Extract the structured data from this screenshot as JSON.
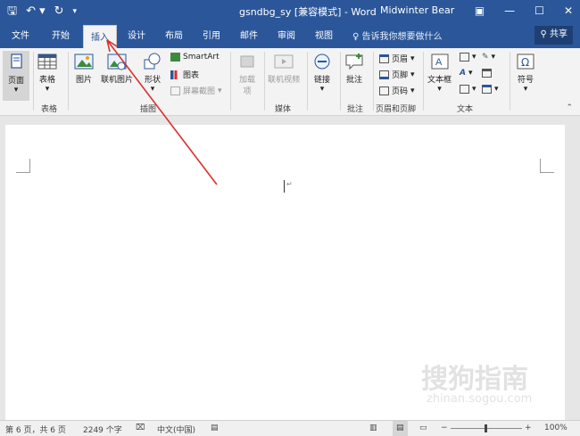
{
  "titlebar": {
    "title": "gsndbg_sy [兼容模式] - Word",
    "user": "Midwinter Bear",
    "qat": {
      "save": "🖫",
      "undo": "↶ ▾",
      "redo": "↻",
      "customize": "▾"
    },
    "window_buttons": {
      "ribbon_display": "▣",
      "minimize": "—",
      "maximize": "☐",
      "close": "✕"
    }
  },
  "tabs": [
    "文件",
    "开始",
    "插入",
    "设计",
    "布局",
    "引用",
    "邮件",
    "审阅",
    "视图"
  ],
  "active_tab": "插入",
  "tell_me": "告诉我你想要做什么",
  "share": "共享",
  "ribbon": {
    "pages": {
      "label": "页面",
      "group": ""
    },
    "tables": {
      "label": "表格",
      "group": "表格"
    },
    "illustrations": {
      "group": "插图",
      "picture": "图片",
      "online_picture": "联机图片",
      "shapes": "形状",
      "smartart": "SmartArt",
      "chart": "图表",
      "screenshot": "屏幕截图"
    },
    "addins": {
      "label": "加载项",
      "label_line1": "加载",
      "label_line2": "项"
    },
    "media": {
      "online_video": "联机视频",
      "group": "媒体"
    },
    "links": {
      "label": "链接",
      "group": ""
    },
    "comments": {
      "label": "批注",
      "group": "批注"
    },
    "header_footer": {
      "header": "页眉",
      "footer": "页脚",
      "page_number": "页码",
      "group": "页眉和页脚"
    },
    "text": {
      "textbox": "文本框",
      "group": "文本"
    },
    "symbols": {
      "label": "符号"
    }
  },
  "statusbar": {
    "page": "第 6 页，共 6 页",
    "words": "2249 个字",
    "language": "中文(中国)",
    "zoom": "100%",
    "zoom_minus": "−",
    "zoom_plus": "+"
  },
  "watermark": {
    "brand": "搜狗指南",
    "url": "zhinan.sogou.com"
  },
  "colors": {
    "word_blue": "#2b579a",
    "annotation_arrow": "#d9302c"
  }
}
